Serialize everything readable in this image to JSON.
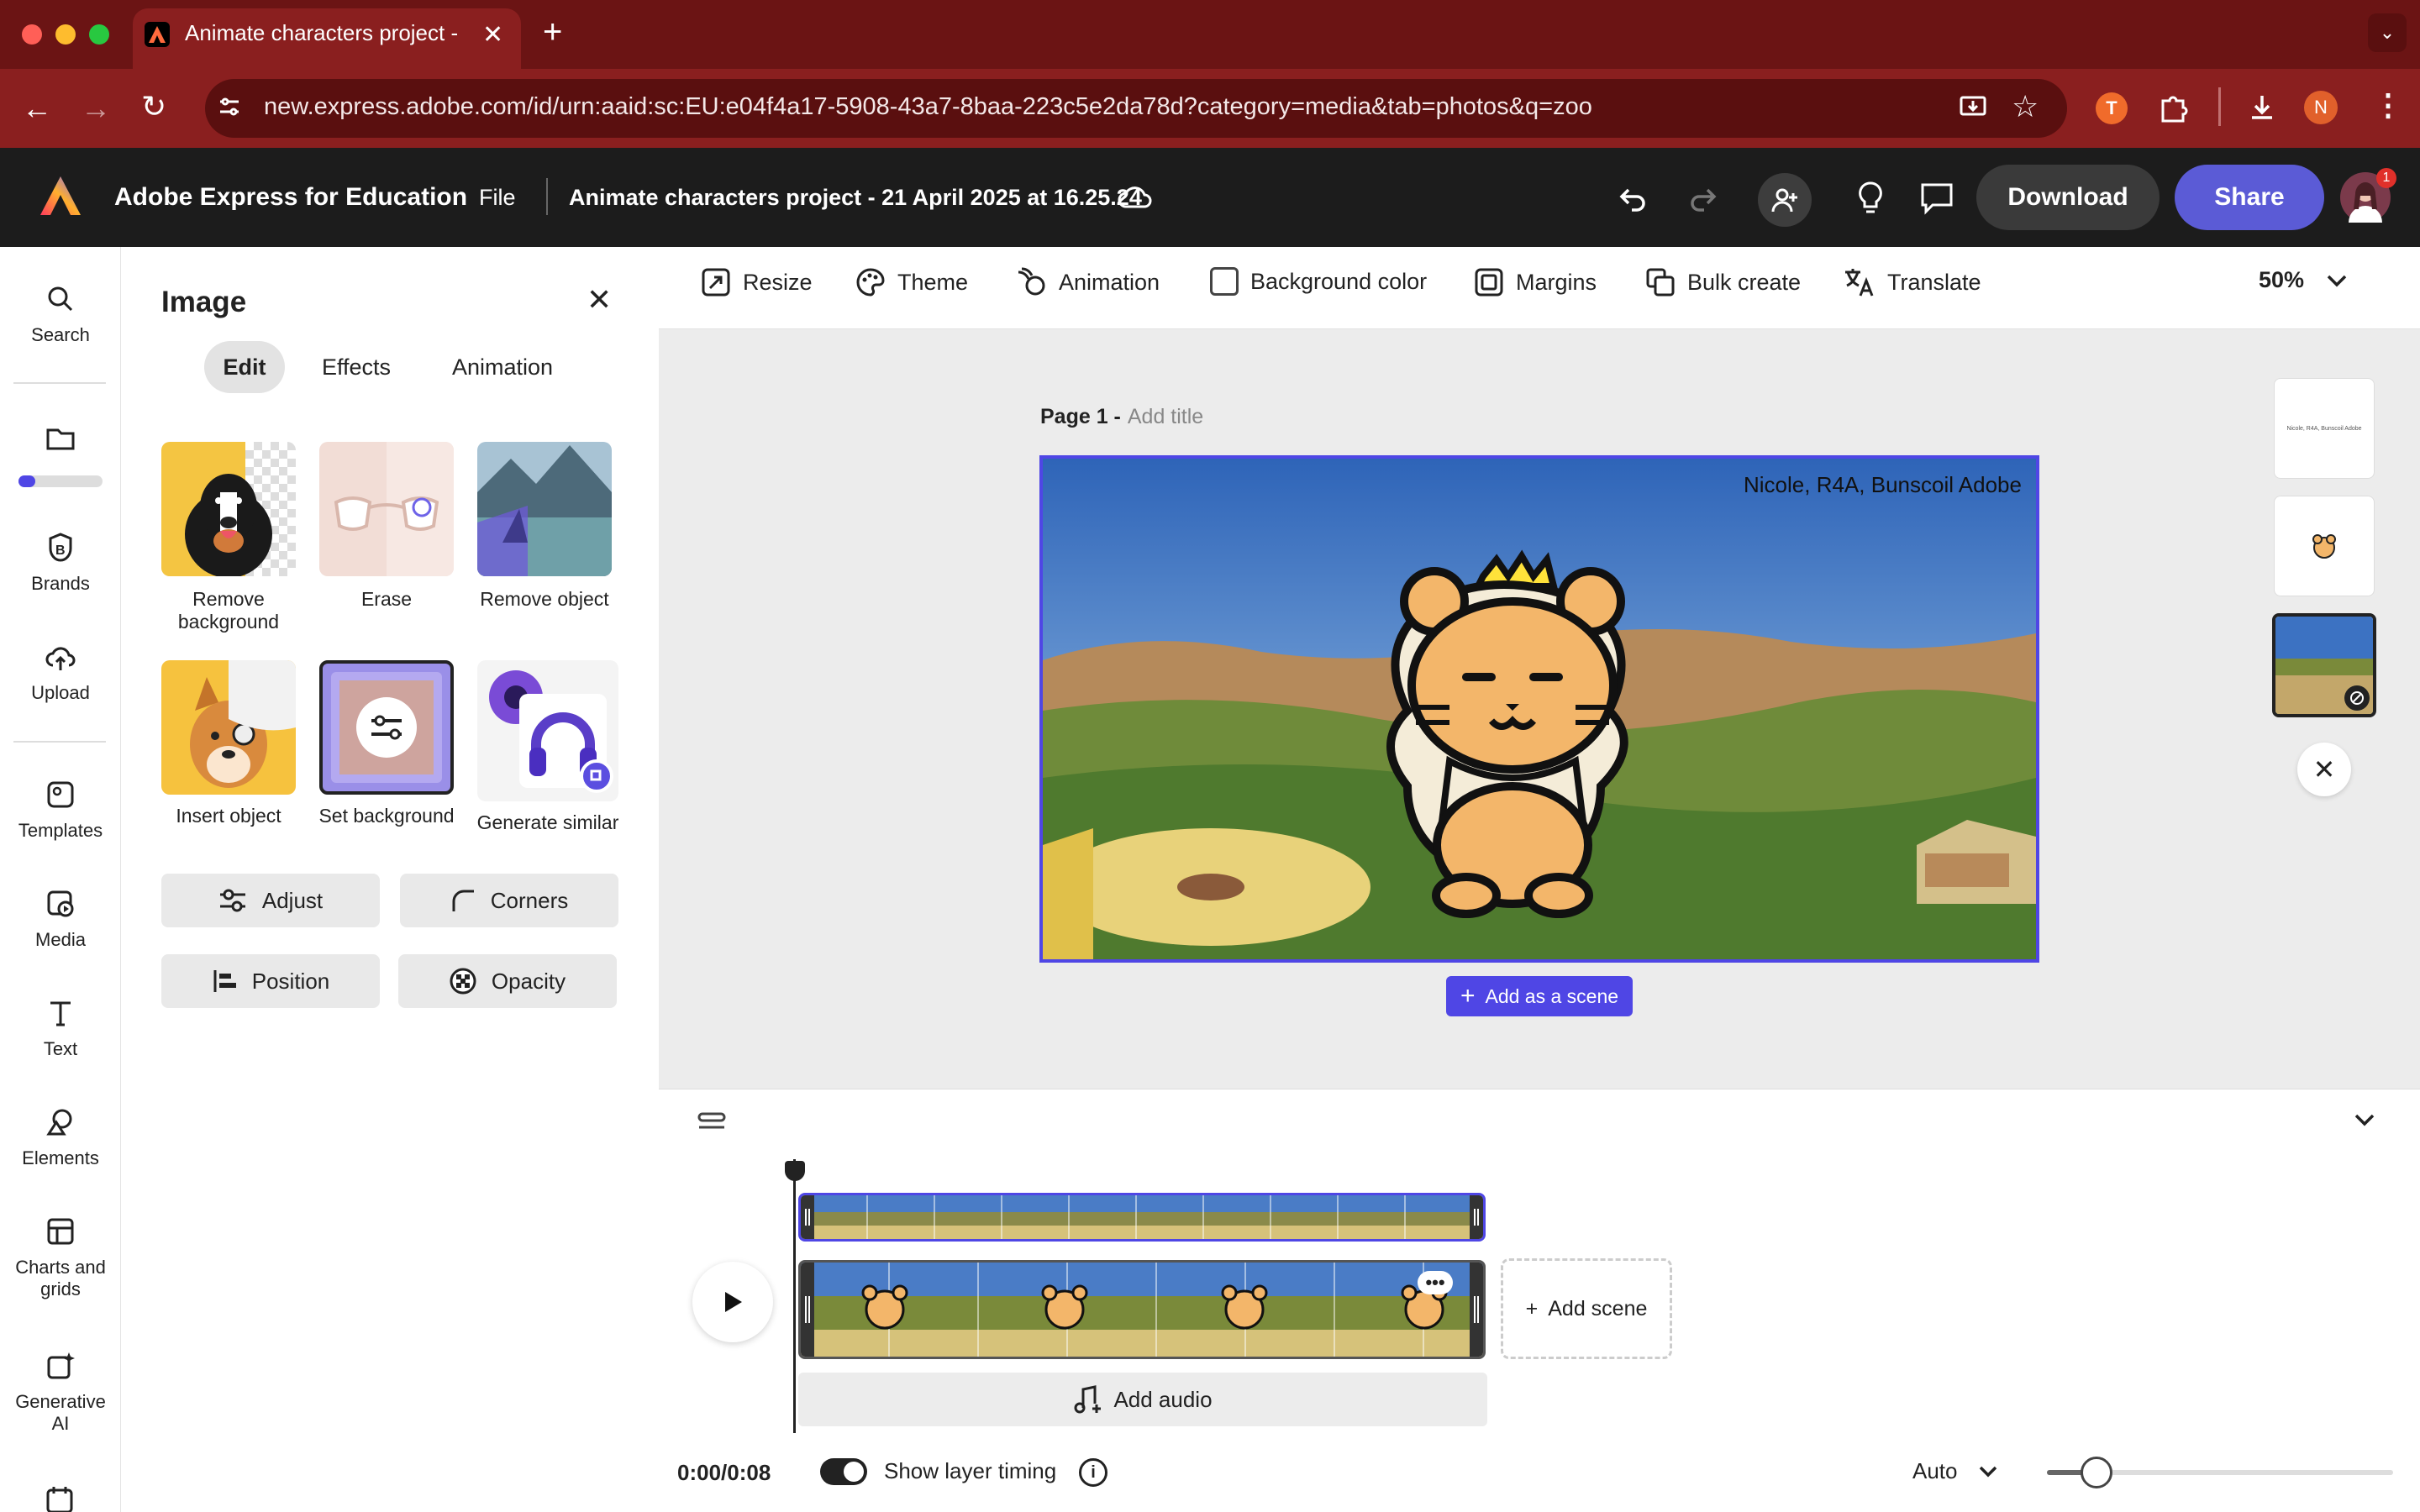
{
  "browser": {
    "tab_title": "Animate characters project -",
    "url": "new.express.adobe.com/id/urn:aaid:sc:EU:e04f4a17-5908-43a7-8baa-223c5e2da78d?category=media&tab=photos&q=zoo",
    "profile_initial": "N"
  },
  "app": {
    "name": "Adobe Express for Education",
    "file_menu": "File",
    "doc_title": "Animate characters project - 21 April 2025 at 16.25.24",
    "download": "Download",
    "share": "Share",
    "notification_count": "1"
  },
  "rail": {
    "search": "Search",
    "brands": "Brands",
    "upload": "Upload",
    "templates": "Templates",
    "media": "Media",
    "text": "Text",
    "elements": "Elements",
    "charts_line1": "Charts and",
    "charts_line2": "grids",
    "genai_line1": "Generative",
    "genai_line2": "AI"
  },
  "panel": {
    "title": "Image",
    "tabs": [
      "Edit",
      "Effects",
      "Animation"
    ],
    "tools": {
      "remove_bg_1": "Remove",
      "remove_bg_2": "background",
      "erase": "Erase",
      "remove_object": "Remove object",
      "insert_object": "Insert object",
      "set_background": "Set background",
      "generate_similar": "Generate similar"
    },
    "buttons": {
      "adjust": "Adjust",
      "corners": "Corners",
      "position": "Position",
      "opacity": "Opacity"
    }
  },
  "toolbar": {
    "resize": "Resize",
    "theme": "Theme",
    "animation": "Animation",
    "background_color": "Background color",
    "margins": "Margins",
    "bulk_create": "Bulk create",
    "translate": "Translate",
    "zoom": "50%"
  },
  "canvas": {
    "page_label": "Page 1 -",
    "add_title": "Add title",
    "caption": "Nicole, R4A, Bunscoil Adobe",
    "add_as_scene": "Add as a scene"
  },
  "timeline": {
    "add_scene": "Add scene",
    "add_audio": "Add audio",
    "time": "0:00/0:08",
    "show_layer_timing": "Show layer timing",
    "auto": "Auto"
  },
  "colors": {
    "accent": "#4f46e5",
    "browser_frame": "#8a1f1f",
    "app_header": "#1c1c1c"
  }
}
